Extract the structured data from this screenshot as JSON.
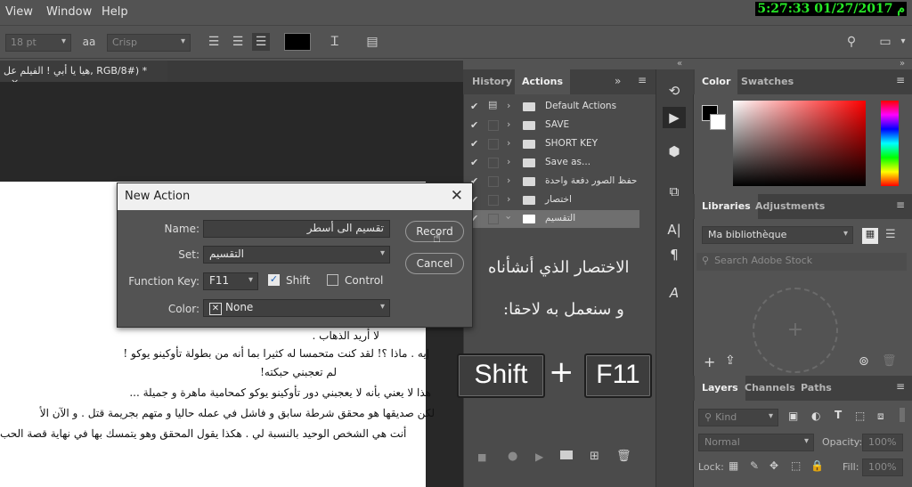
{
  "menubar": {
    "items": [
      "View",
      "Window",
      "Help"
    ],
    "clock": "5:27:33 01/27/2017 م"
  },
  "options": {
    "font_size": "18 pt",
    "aa_icon": "aa",
    "antialias": "Crisp",
    "color_swatch": "#000000"
  },
  "document": {
    "tab_title": "هيا يا أبي ! الفيلم عل, RGB/8#) *",
    "close": "×",
    "text_lines": [
      "لا أريد الذهاب .",
      "إيه . ماذا ؟! لقد كنت متحمسا له كثيرا بما أنه من بطولة تأوكينو يوكو !",
      "لم تعجبني حبكته!",
      "هذا لا يعني بأنه لا يعجبني دور تأوكينو يوكو كمحامية ماهرة و جميلة ...",
      "لكن صديقها هو محقق شرطة سابق و فاشل في عمله حاليا و متهم بجريمة قتل .  و الآن الأ",
      "أنت هي الشخص الوحيد بالنسبة لي . هكذا يقول المحقق وهو يتمسك بها في نهاية قصة الحب"
    ]
  },
  "actions_panel": {
    "tabs": [
      "History",
      "Actions"
    ],
    "rows": [
      {
        "label": "Default Actions"
      },
      {
        "label": "SAVE"
      },
      {
        "label": "SHORT KEY"
      },
      {
        "label": "Save as..."
      },
      {
        "label": "حفظ الصور دفعة واحدة"
      },
      {
        "label": "اختصار"
      },
      {
        "label": "التقسيم"
      }
    ],
    "overlay_line1": "الاختصار الذي أنشأناه",
    "overlay_line2": "و سنعمل به لاحقا:",
    "key1": "Shift",
    "plus": "+",
    "key2": "F11"
  },
  "dialog": {
    "title": "New Action",
    "name_label": "Name:",
    "name_value": "تقسيم الى أسطر",
    "set_label": "Set:",
    "set_value": "التقسيم",
    "fkey_label": "Function Key:",
    "fkey_value": "F11",
    "shift_label": "Shift",
    "control_label": "Control",
    "color_label": "Color:",
    "color_value": "None",
    "record_button": "Record",
    "cancel_button": "Cancel"
  },
  "color_panel": {
    "tabs": [
      "Color",
      "Swatches"
    ]
  },
  "libraries_panel": {
    "tabs": [
      "Libraries",
      "Adjustments"
    ],
    "library": "Ma bibliothèque",
    "search_placeholder": "Search Adobe Stock"
  },
  "layers_panel": {
    "tabs": [
      "Layers",
      "Channels",
      "Paths"
    ],
    "kind": "Kind",
    "blend_mode": "Normal",
    "opacity_label": "Opacity:",
    "opacity_value": "100%",
    "lock_label": "Lock:",
    "fill_label": "Fill:",
    "fill_value": "100%"
  }
}
